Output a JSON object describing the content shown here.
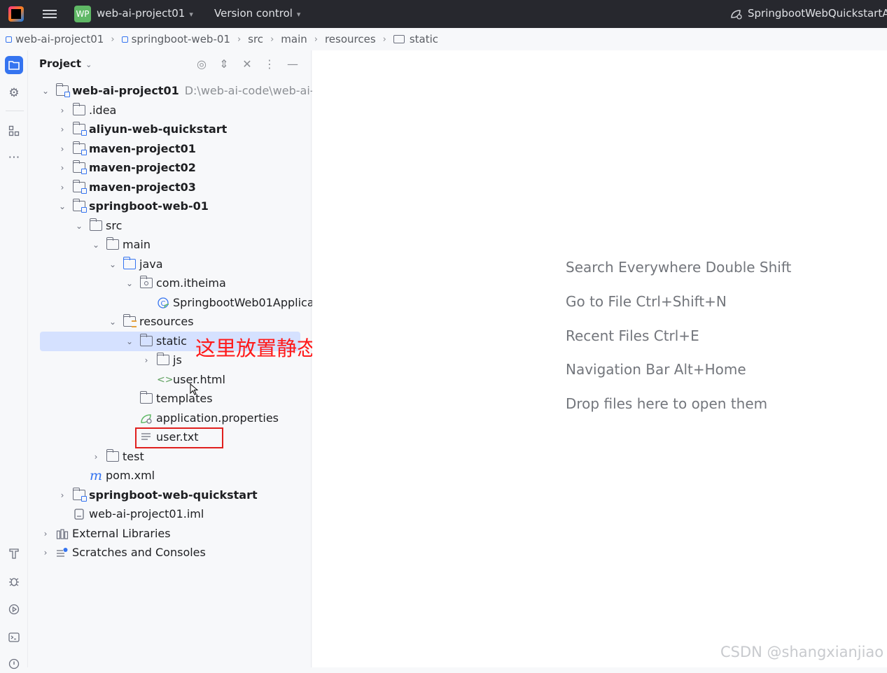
{
  "titlebar": {
    "project_badge": "WP",
    "project_name": "web-ai-project01",
    "vcs_label": "Version control",
    "run_config": "SpringbootWebQuickstartA"
  },
  "breadcrumb": [
    "web-ai-project01",
    "springboot-web-01",
    "src",
    "main",
    "resources",
    "static"
  ],
  "panel": {
    "title": "Project"
  },
  "tree": [
    {
      "label": "web-ai-project01",
      "hint": "D:\\web-ai-code\\web-ai-p"
    },
    {
      "label": ".idea"
    },
    {
      "label": "aliyun-web-quickstart"
    },
    {
      "label": "maven-project01"
    },
    {
      "label": "maven-project02"
    },
    {
      "label": "maven-project03"
    },
    {
      "label": "springboot-web-01"
    },
    {
      "label": "src"
    },
    {
      "label": "main"
    },
    {
      "label": "java"
    },
    {
      "label": "com.itheima"
    },
    {
      "label": "SpringbootWeb01Applica"
    },
    {
      "label": "resources"
    },
    {
      "label": "static"
    },
    {
      "label": "js"
    },
    {
      "label": "user.html"
    },
    {
      "label": "templates"
    },
    {
      "label": "application.properties"
    },
    {
      "label": "user.txt"
    },
    {
      "label": "test"
    },
    {
      "label": "pom.xml"
    },
    {
      "label": "springboot-web-quickstart"
    },
    {
      "label": "web-ai-project01.iml"
    },
    {
      "label": "External Libraries"
    },
    {
      "label": "Scratches and Consoles"
    }
  ],
  "annotation": "这里放置静态资源",
  "editor_hints": [
    "Search Everywhere Double Shift",
    "Go to File Ctrl+Shift+N",
    "Recent Files Ctrl+E",
    "Navigation Bar Alt+Home",
    "Drop files here to open them"
  ],
  "watermark": "CSDN @shangxianjiao",
  "colors": {
    "accent": "#3574f0",
    "selection": "#d5e1ff",
    "annotation": "#ff1a1a",
    "titlebar": "#27282e"
  }
}
